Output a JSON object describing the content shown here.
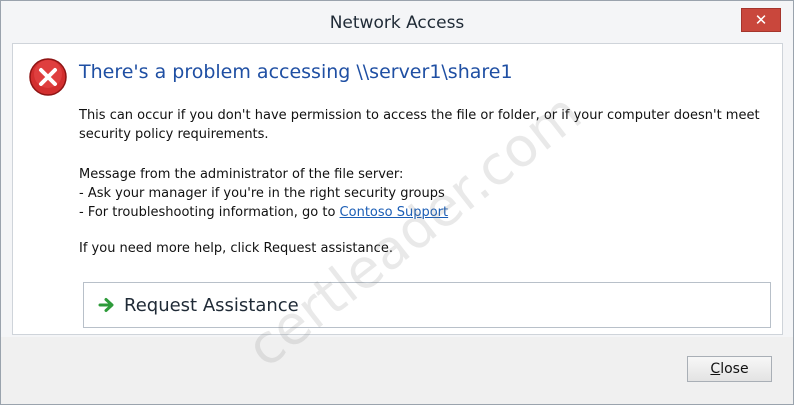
{
  "window": {
    "title": "Network Access",
    "close_glyph": "✕"
  },
  "dialog": {
    "icon": "error-icon",
    "heading": "There's a problem accessing \\\\server1\\share1",
    "paragraph1": "This can occur if you don't have permission to access the file or folder, or if your computer doesn't meet security policy requirements.",
    "admin_message_title": "Message from the administrator of the file server:",
    "admin_line1": "- Ask your manager if you're in the right security groups",
    "admin_line2_prefix": "- For troubleshooting information, go to ",
    "admin_link": "Contoso Support",
    "help_text": "If you need more help, click Request assistance.",
    "assist_label": "Request Assistance"
  },
  "footer": {
    "close_button_first": "C",
    "close_button_rest": "lose"
  },
  "watermark": "certleader.com",
  "colors": {
    "heading": "#1f4fa3",
    "link": "#1a5db5",
    "error_red": "#c62828",
    "arrow_green": "#2e9b3a"
  }
}
